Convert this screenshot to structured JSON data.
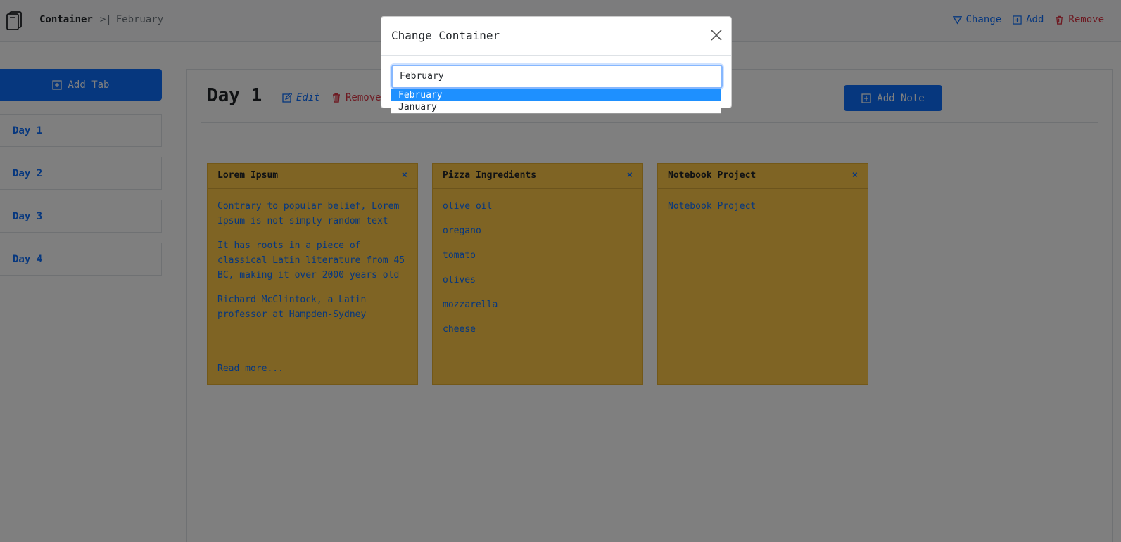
{
  "topbar": {
    "logo_icon": "notebook-icon",
    "breadcrumb": [
      "Container",
      "February"
    ],
    "separator": ">|",
    "actions": [
      {
        "label": "Change",
        "icon": "triangle-down-icon",
        "color": "#0d6efd"
      },
      {
        "label": "Add",
        "icon": "plus-square-icon",
        "color": "#0d6efd"
      },
      {
        "label": "Remove",
        "icon": "trash-icon",
        "color": "#dc3545"
      }
    ]
  },
  "sidebar": {
    "add_tab_label": "Add Tab",
    "tabs": [
      "Day 1",
      "Day 2",
      "Day 3",
      "Day 4"
    ]
  },
  "main": {
    "title": "Day 1",
    "edit_label": "Edit",
    "remove_label": "Remove",
    "add_note_label": "Add Note",
    "notes": [
      {
        "title": "Lorem Ipsum",
        "close": "×",
        "paragraphs": [
          "Contrary to popular belief, Lorem Ipsum is not simply random text",
          "It has roots in a piece of classical Latin literature from 45 BC, making it over 2000 years old",
          "Richard McClintock, a Latin professor at Hampden-Sydney"
        ],
        "read_more": "Read more..."
      },
      {
        "title": "Pizza Ingredients",
        "close": "×",
        "paragraphs": [
          "olive oil",
          "oregano",
          "tomato",
          "olives",
          "mozzarella",
          "cheese"
        ]
      },
      {
        "title": "Notebook Project",
        "close": "×",
        "paragraphs": [
          "Notebook Project"
        ]
      }
    ]
  },
  "modal": {
    "title": "Change Container",
    "select_value": "February",
    "options": [
      "February",
      "January"
    ],
    "selected_option": "February"
  },
  "colors": {
    "primary": "#0d6efd",
    "danger": "#dc3545",
    "note": "#ffc848"
  }
}
